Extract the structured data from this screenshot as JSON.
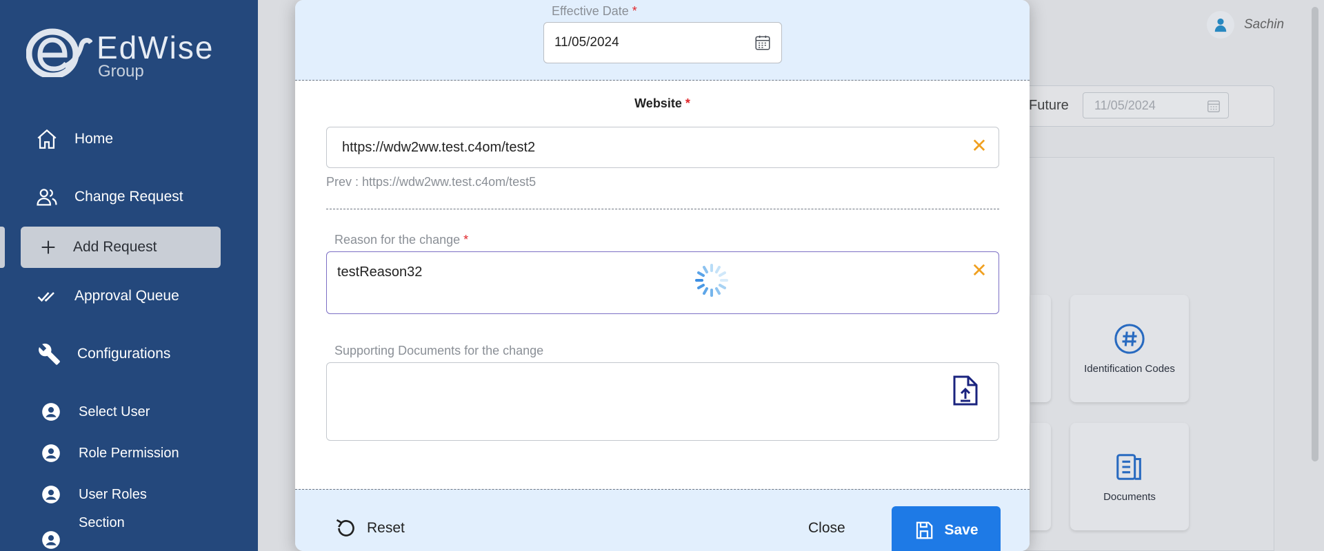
{
  "sidebar": {
    "logo": {
      "text": "EdWise",
      "sub": "Group"
    },
    "items": [
      {
        "label": "Home",
        "icon": "home-icon"
      },
      {
        "label": "Change Request",
        "icon": "users-icon"
      },
      {
        "label": "Add Request",
        "icon": "plus-icon",
        "active": true
      },
      {
        "label": "Approval Queue",
        "icon": "double-check-icon"
      },
      {
        "label": "Configurations",
        "icon": "wrench-icon"
      },
      {
        "label": "Select User",
        "icon": "user-circle-icon"
      },
      {
        "label": "Role Permission",
        "icon": "user-circle-icon"
      },
      {
        "label": "User Roles",
        "icon": "user-circle-icon"
      },
      {
        "label": "Section",
        "icon": "user-circle-icon"
      }
    ]
  },
  "header": {
    "user_name": "Sachin"
  },
  "background": {
    "future_label": "Future",
    "future_date": "11/05/2024",
    "tiles": [
      {
        "label": "Identification Codes",
        "icon": "hash-icon"
      },
      {
        "label": "Documents",
        "icon": "document-icon"
      }
    ]
  },
  "modal": {
    "effective_date": {
      "label": "Effective Date",
      "required": "*",
      "value": "11/05/2024"
    },
    "website": {
      "label": "Website",
      "required": "*",
      "value": "https://wdw2ww.test.c4om/test2",
      "prev": "Prev : https://wdw2ww.test.c4om/test5"
    },
    "reason": {
      "label": "Reason for the change",
      "required": "*",
      "value": "testReason32"
    },
    "documents": {
      "label": "Supporting Documents for the change"
    },
    "footer": {
      "reset": "Reset",
      "close": "Close",
      "save": "Save"
    }
  },
  "colors": {
    "sidebar_bg": "#24487c",
    "modal_header_bg": "#e2effd",
    "accent": "#1e7ae6",
    "clear_icon": "#f0a020",
    "required": "#e0262b"
  }
}
